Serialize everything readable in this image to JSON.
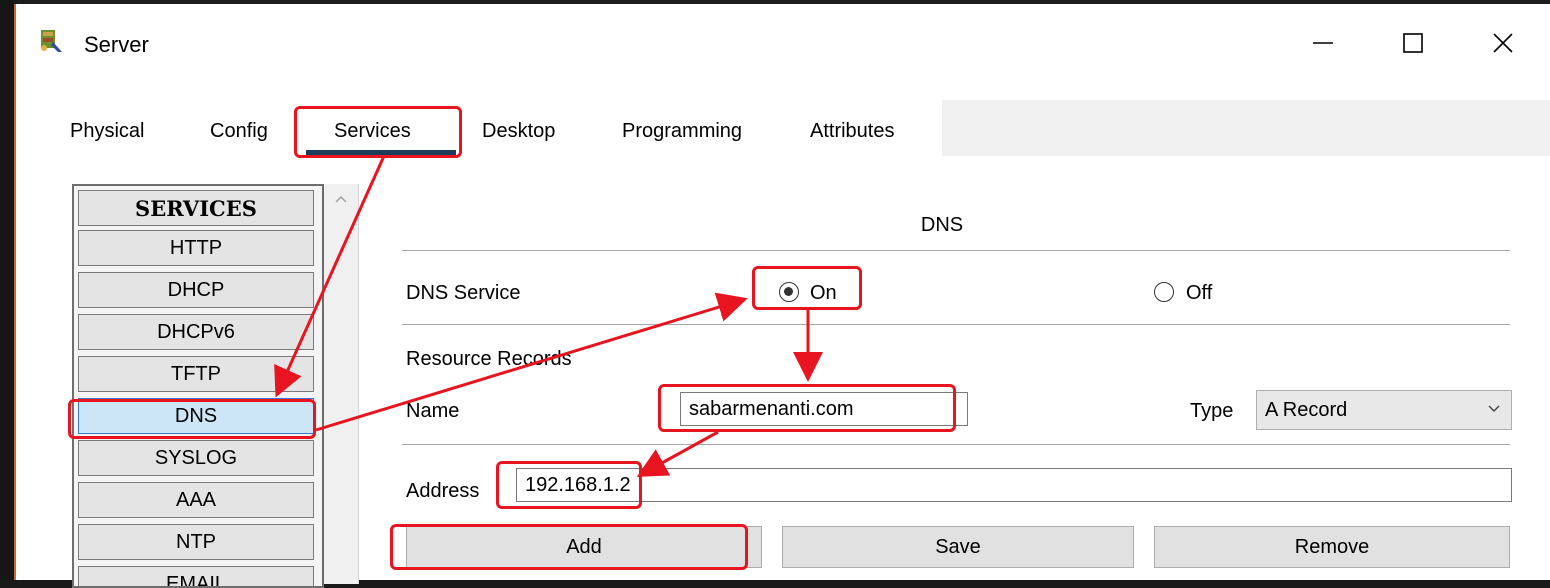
{
  "window": {
    "title": "Server",
    "minimize_icon": "minimize-icon",
    "maximize_icon": "maximize-icon",
    "close_icon": "close-icon"
  },
  "tabs": [
    {
      "label": "Physical"
    },
    {
      "label": "Config"
    },
    {
      "label": "Services",
      "selected": true
    },
    {
      "label": "Desktop"
    },
    {
      "label": "Programming"
    },
    {
      "label": "Attributes"
    }
  ],
  "services": {
    "header": "SERVICES",
    "items": [
      "HTTP",
      "DHCP",
      "DHCPv6",
      "TFTP",
      "DNS",
      "SYSLOG",
      "AAA",
      "NTP",
      "EMAIL"
    ],
    "selected": "DNS"
  },
  "dns": {
    "title": "DNS",
    "service_label": "DNS Service",
    "on_label": "On",
    "off_label": "Off",
    "service_state": "On",
    "records_label": "Resource Records",
    "name_label": "Name",
    "name_value": "sabarmenanti.com",
    "type_label": "Type",
    "type_value": "A Record",
    "address_label": "Address",
    "address_value": "192.168.1.2",
    "add_label": "Add",
    "save_label": "Save",
    "remove_label": "Remove"
  },
  "colors": {
    "annotation": "#e8141f",
    "selected_item": "#cde6f7",
    "tab_underline": "#1c3c5a"
  }
}
